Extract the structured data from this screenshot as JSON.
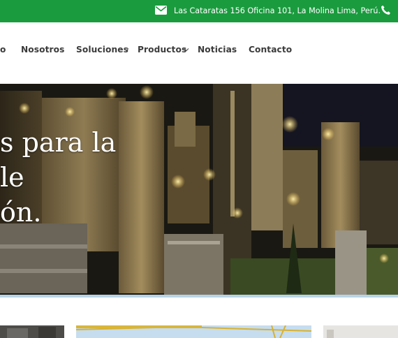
{
  "topbar": {
    "address": "Las Cataratas 156 Oficina 101, La Molina Lima, Perú.",
    "mail_icon": "envelope-icon",
    "phone_icon": "phone-icon",
    "color": "#1a9b3e"
  },
  "nav": {
    "items": [
      {
        "label": "o"
      },
      {
        "label": "Nosotros"
      },
      {
        "label": "Soluciones"
      },
      {
        "label": "Productos"
      },
      {
        "label": "Noticias"
      },
      {
        "label": "Contacto"
      }
    ]
  },
  "hero": {
    "lines": [
      "s para la",
      "le",
      "ón."
    ]
  }
}
